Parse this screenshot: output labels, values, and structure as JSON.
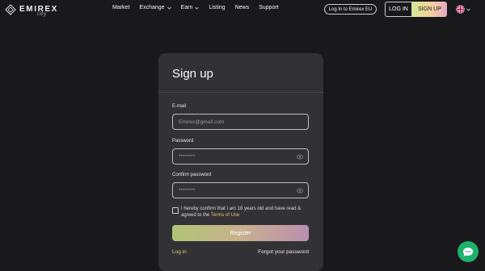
{
  "header": {
    "logo_text": "EMIREX",
    "logo_sub": "сity",
    "nav": [
      {
        "label": "Market",
        "dropdown": false
      },
      {
        "label": "Exchange",
        "dropdown": true
      },
      {
        "label": "Earn",
        "dropdown": true
      },
      {
        "label": "Listing",
        "dropdown": false
      },
      {
        "label": "News",
        "dropdown": false
      },
      {
        "label": "Support",
        "dropdown": false
      }
    ],
    "eu_login_label": "Log In to Emirex EU",
    "login_label": "LOG IN",
    "signup_label": "SIGN UP",
    "language_icon": "uk-flag-icon"
  },
  "form": {
    "title": "Sign up",
    "email_label": "E-mail",
    "email_placeholder": "Emirex@gmail.com",
    "password_label": "Password",
    "password_value": "********",
    "confirm_label": "Confirm password",
    "confirm_value": "********",
    "consent_text": "I hereby confirm that I am 18 years old and have read & agreed to the ",
    "terms_link": "Terms of Use",
    "register_label": "Register",
    "login_link": "Log in",
    "forgot_link": "Forgot your password"
  },
  "colors": {
    "background": "#19191b",
    "card": "#323236",
    "accent_link": "#e4c57a",
    "chat_button": "#1fb16a"
  }
}
